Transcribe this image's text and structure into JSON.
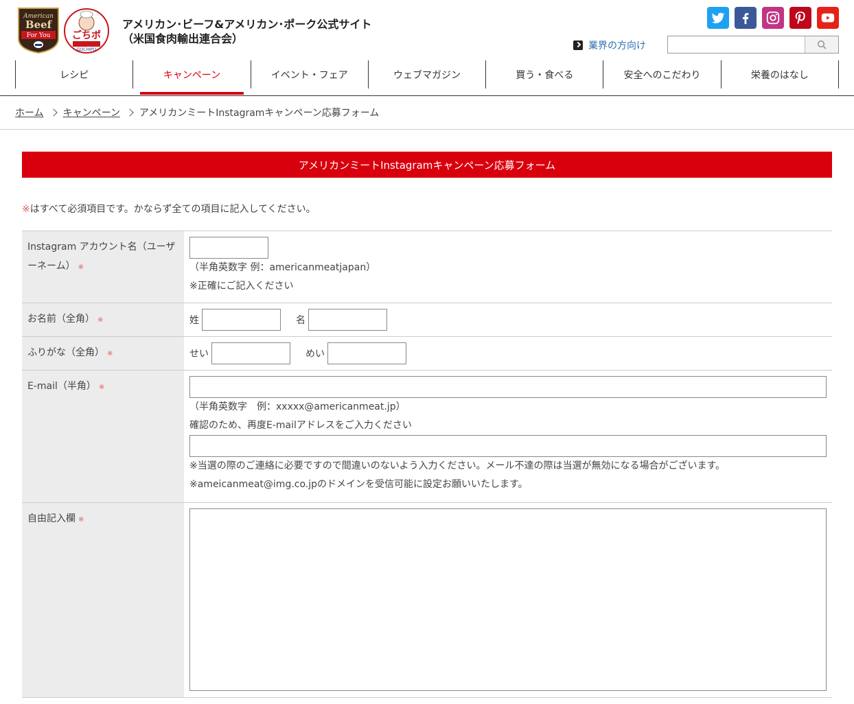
{
  "header": {
    "logo_beef": {
      "line1": "American",
      "line2": "Beef",
      "line3": "For You"
    },
    "logo_gochipo": {
      "main": "ごちポ",
      "sub": "GOCHIPO"
    },
    "title_line1": "アメリカン･ビーフ&アメリカン･ポーク公式サイト",
    "title_line2": "（米国食肉輸出連合会）",
    "industry_link": "業界の方向け",
    "search_placeholder": ""
  },
  "sns": [
    {
      "name": "twitter",
      "color": "#1da1f2"
    },
    {
      "name": "facebook",
      "color": "#3b5998"
    },
    {
      "name": "instagram",
      "color": "#c13584"
    },
    {
      "name": "pinterest",
      "color": "#bd081c"
    },
    {
      "name": "youtube",
      "color": "#e62117"
    }
  ],
  "nav": [
    {
      "label": "レシピ",
      "active": false
    },
    {
      "label": "キャンペーン",
      "active": true
    },
    {
      "label": "イベント・フェア",
      "active": false
    },
    {
      "label": "ウェブマガジン",
      "active": false
    },
    {
      "label": "買う・食べる",
      "active": false
    },
    {
      "label": "安全へのこだわり",
      "active": false
    },
    {
      "label": "栄養のはなし",
      "active": false
    }
  ],
  "breadcrumb": {
    "home": "ホーム",
    "campaign": "キャンペーン",
    "current": "アメリカンミートInstagramキャンペーン応募フォーム"
  },
  "form": {
    "title": "アメリカンミートInstagramキャンペーン応募フォーム",
    "required_mark": "※",
    "required_note": "はすべて必須項目です。かならず全ての項目に記入してください。",
    "instagram": {
      "label": "Instagram アカウント名（ユーザーネーム）",
      "hint1": "（半角英数字 例：americanmeatjapan）",
      "hint2": "※正確にご記入ください",
      "value": ""
    },
    "name": {
      "label": "お名前（全角）",
      "last_label": "姓",
      "first_label": "名",
      "last_value": "",
      "first_value": ""
    },
    "furigana": {
      "label": "ふりがな（全角）",
      "last_label": "せい",
      "first_label": "めい",
      "last_value": "",
      "first_value": ""
    },
    "email": {
      "label": "E-mail（半角）",
      "hint1": "（半角英数字　例：xxxxx@americanmeat.jp）",
      "confirm_label": "確認のため、再度E-mailアドレスをご入力ください",
      "note1": "※当選の際のご連絡に必要ですので間違いのないよう入力ください。メール不達の際は当選が無効になる場合がございます。",
      "note2": "※ameicanmeat@img.co.jpのドメインを受信可能に設定お願いいたします。",
      "value": "",
      "confirm_value": ""
    },
    "free": {
      "label": "自由記入欄",
      "value": ""
    }
  }
}
